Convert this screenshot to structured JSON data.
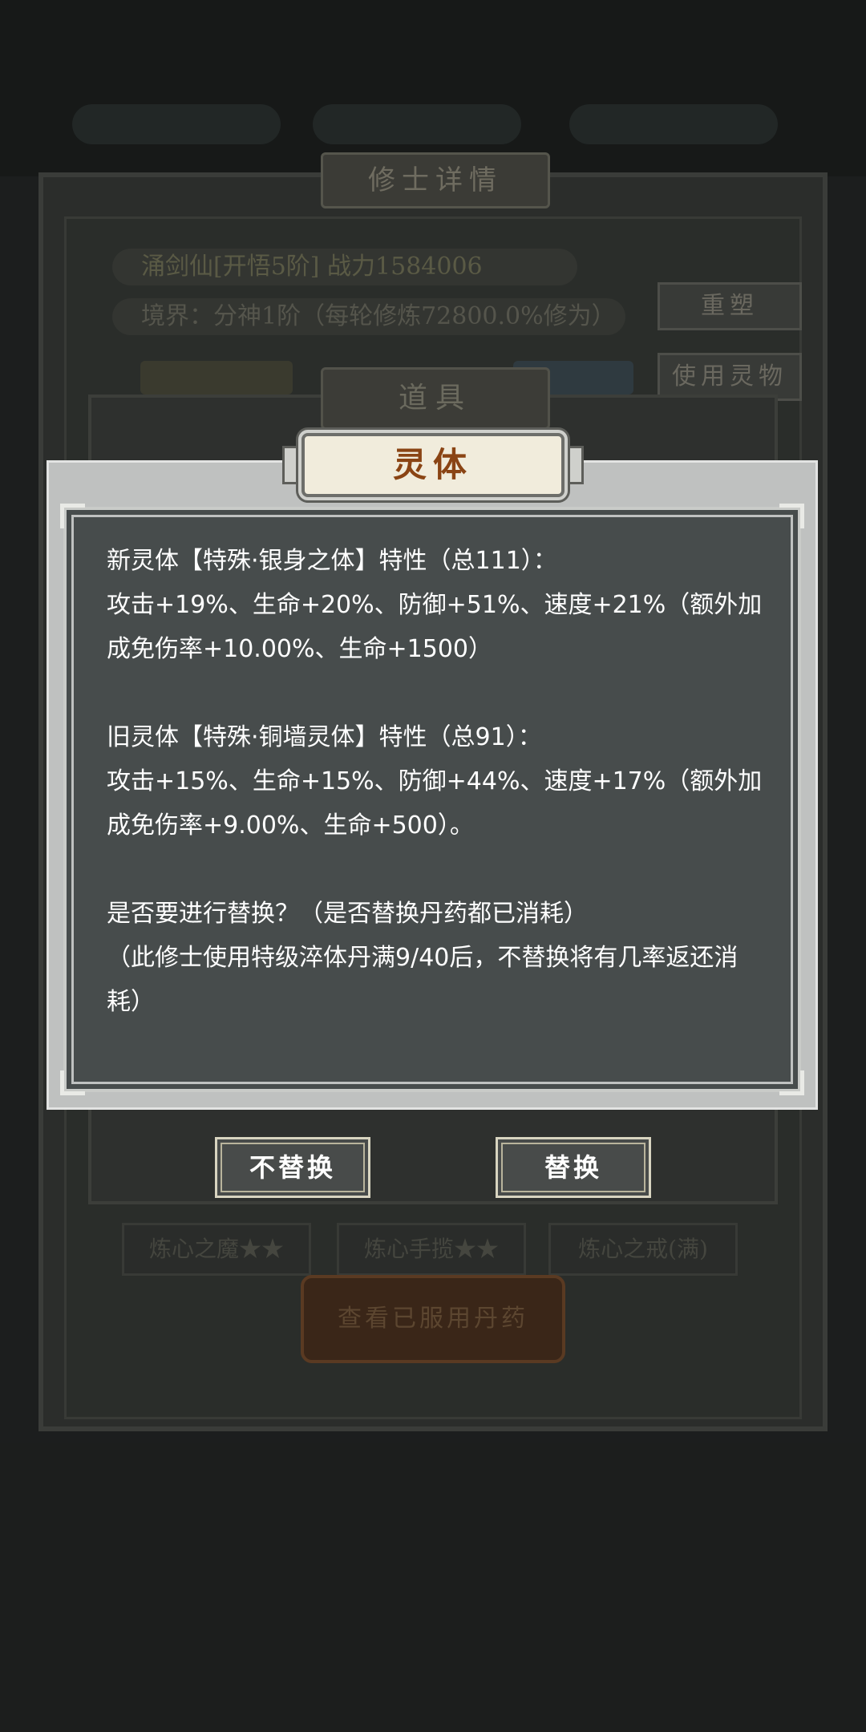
{
  "background": {
    "title": "修士详情",
    "name_row": "涌剑仙[开悟5阶] 战力1584006",
    "realm_row": "境界：分神1阶（每轮修炼72800.0%修为）",
    "side_buttons": [
      "重塑",
      "使用灵物"
    ],
    "items_title": "道具",
    "pills": [
      "炼心之魔★★",
      "炼心手揽★★",
      "炼心之戒(满)"
    ],
    "view_button": "查看已服用丹药"
  },
  "dialog": {
    "title": "灵体",
    "new_header": "新灵体【特殊·银身之体】特性（总111）：",
    "new_stats": "攻击+19%、生命+20%、防御+51%、速度+21%（额外加成免伤率+10.00%、生命+1500）",
    "old_header": "旧灵体【特殊·铜墙灵体】特性（总91）：",
    "old_stats": "攻击+15%、生命+15%、防御+44%、速度+17%（额外加成免伤率+9.00%、生命+500）。",
    "question": "是否要进行替换？（是否替换丹药都已消耗）",
    "note": "（此修士使用特级淬体丹满9/40后，不替换将有几率返还消耗）",
    "buttons": {
      "no_replace": "不替换",
      "replace": "替换"
    }
  },
  "colors": {
    "dialog_title_text": "#8a4414",
    "dialog_bg": "#474c4c",
    "dialog_frame": "#bfc1c0"
  }
}
